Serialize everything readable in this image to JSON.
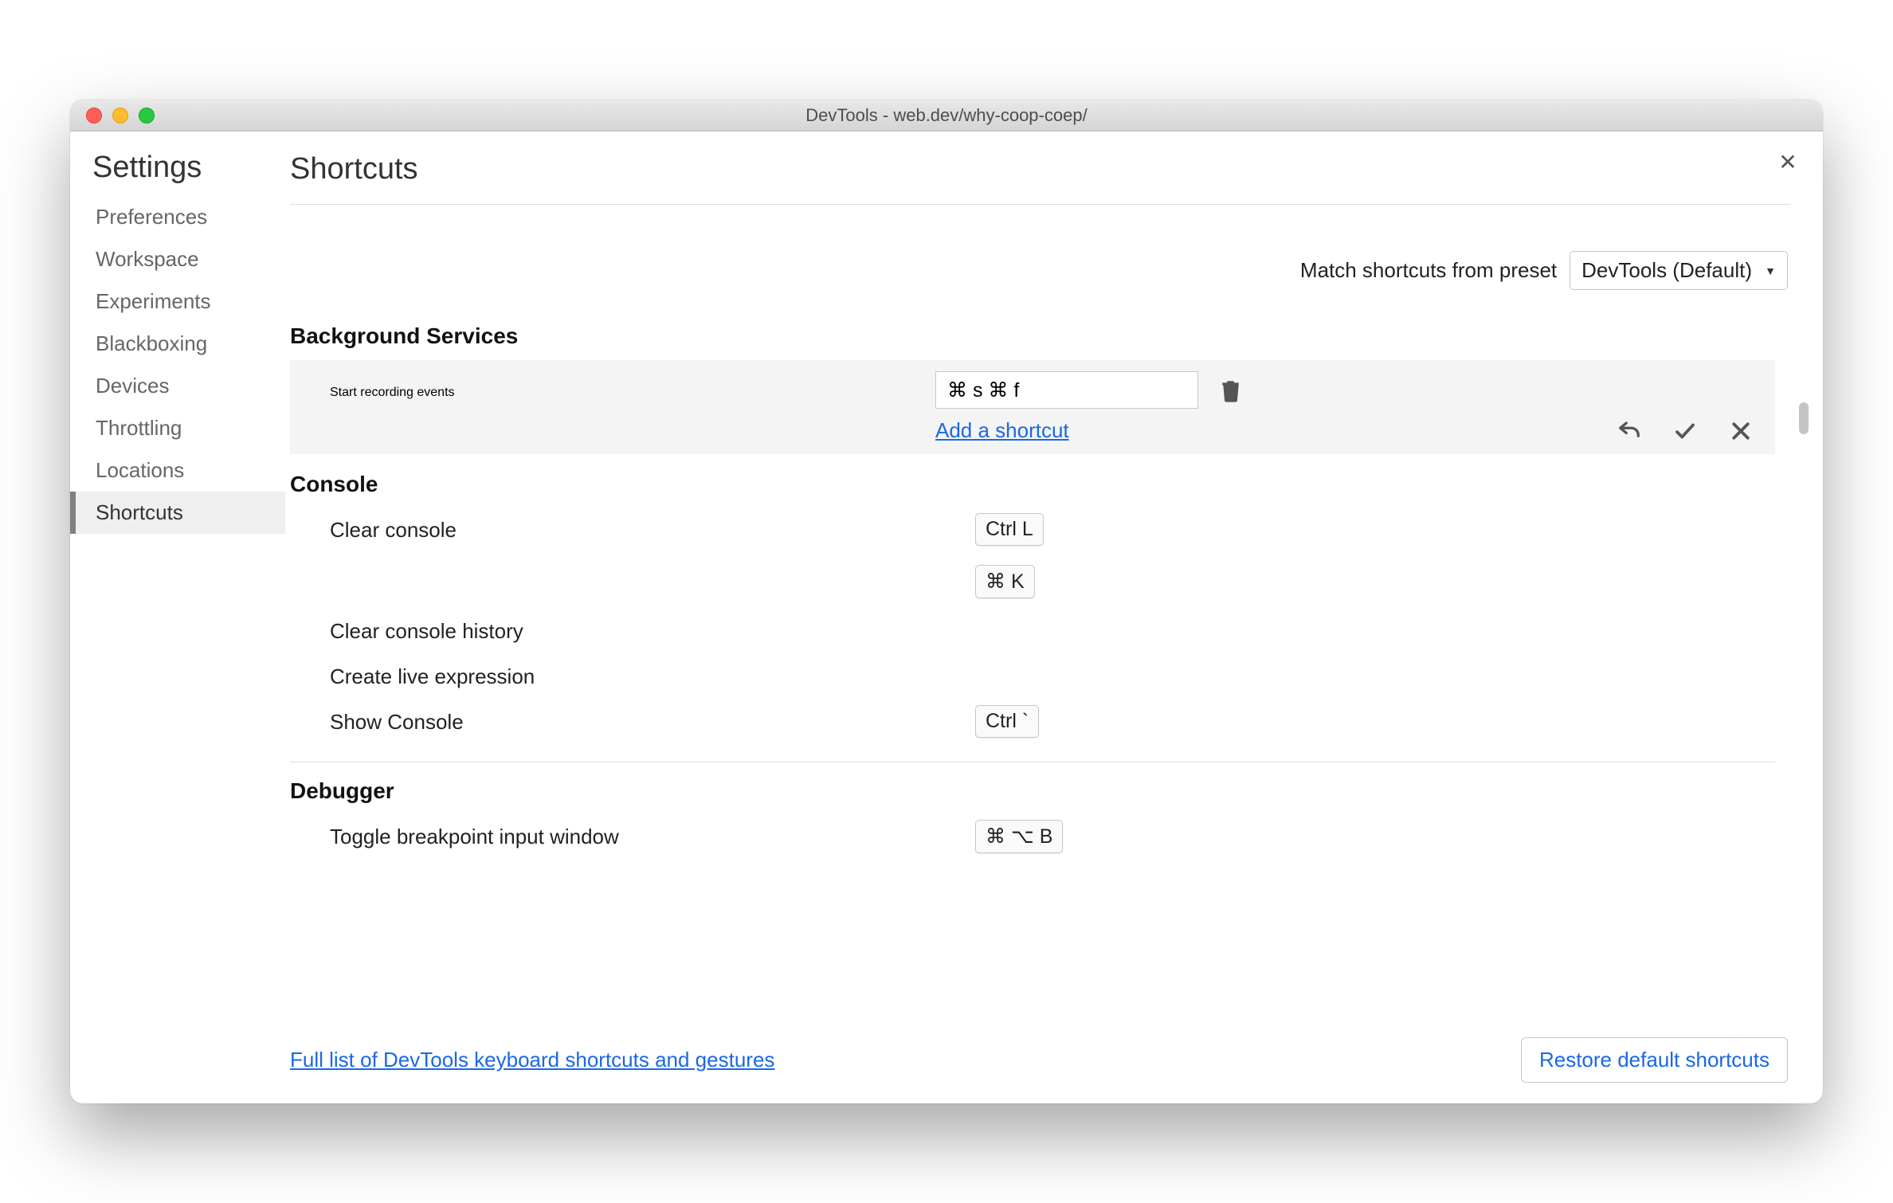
{
  "window": {
    "title": "DevTools - web.dev/why-coop-coep/"
  },
  "sidebar": {
    "title": "Settings",
    "items": [
      "Preferences",
      "Workspace",
      "Experiments",
      "Blackboxing",
      "Devices",
      "Throttling",
      "Locations",
      "Shortcuts"
    ],
    "selected": "Shortcuts"
  },
  "page": {
    "title": "Shortcuts"
  },
  "preset": {
    "label": "Match shortcuts from preset",
    "value": "DevTools (Default)"
  },
  "sections": {
    "backgroundServices": {
      "title": "Background Services",
      "item": {
        "label": "Start recording events",
        "input_value": "⌘ s ⌘ f",
        "add_link": "Add a shortcut"
      }
    },
    "console": {
      "title": "Console",
      "items": [
        {
          "label": "Clear console",
          "keys": [
            "Ctrl L",
            "⌘ K"
          ]
        },
        {
          "label": "Clear console history",
          "keys": []
        },
        {
          "label": "Create live expression",
          "keys": []
        },
        {
          "label": "Show Console",
          "keys": [
            "Ctrl `"
          ]
        }
      ]
    },
    "debugger": {
      "title": "Debugger",
      "items": [
        {
          "label": "Toggle breakpoint input window",
          "keys": [
            "⌘ ⌥ B"
          ]
        }
      ]
    }
  },
  "footer": {
    "full_list_link": "Full list of DevTools keyboard shortcuts and gestures",
    "restore_button": "Restore default shortcuts"
  }
}
